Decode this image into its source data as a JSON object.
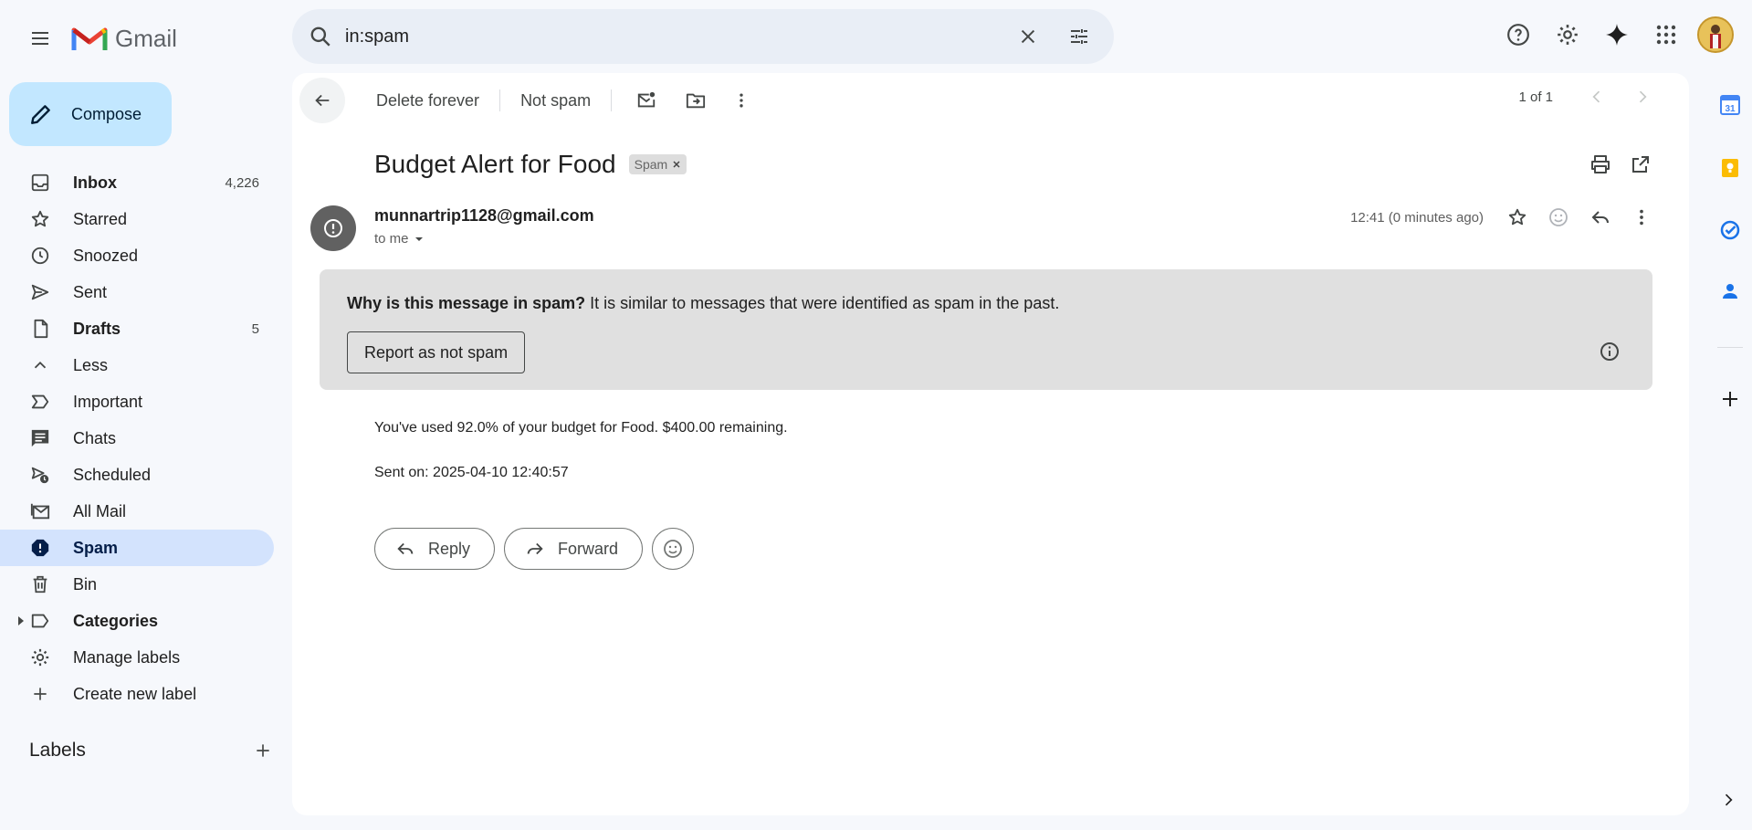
{
  "app": {
    "name": "Gmail"
  },
  "search": {
    "value": "in:spam"
  },
  "compose": {
    "label": "Compose"
  },
  "nav": [
    {
      "label": "Inbox",
      "count": "4,226",
      "icon": "inbox-icon",
      "bold": true
    },
    {
      "label": "Starred",
      "count": "",
      "icon": "star-icon"
    },
    {
      "label": "Snoozed",
      "count": "",
      "icon": "clock-icon"
    },
    {
      "label": "Sent",
      "count": "",
      "icon": "send-icon"
    },
    {
      "label": "Drafts",
      "count": "5",
      "icon": "draft-icon",
      "bold": true
    },
    {
      "label": "Less",
      "count": "",
      "icon": "chevron-up-icon"
    },
    {
      "label": "Important",
      "count": "",
      "icon": "important-icon"
    },
    {
      "label": "Chats",
      "count": "",
      "icon": "chat-icon"
    },
    {
      "label": "Scheduled",
      "count": "",
      "icon": "scheduled-icon"
    },
    {
      "label": "All Mail",
      "count": "",
      "icon": "all-mail-icon"
    },
    {
      "label": "Spam",
      "count": "",
      "icon": "spam-icon",
      "active": true
    },
    {
      "label": "Bin",
      "count": "",
      "icon": "trash-icon"
    },
    {
      "label": "Categories",
      "count": "",
      "icon": "label-icon",
      "bold": true
    },
    {
      "label": "Manage labels",
      "count": "",
      "icon": "gear-icon"
    },
    {
      "label": "Create new label",
      "count": "",
      "icon": "plus-icon"
    }
  ],
  "labels": {
    "title": "Labels"
  },
  "toolbar": {
    "delete_forever": "Delete forever",
    "not_spam": "Not spam"
  },
  "pager": {
    "text": "1 of 1"
  },
  "message": {
    "subject": "Budget Alert for Food",
    "badge": "Spam",
    "sender": "munnartrip1128@gmail.com",
    "to": "to me",
    "time": "12:41 (0 minutes ago)",
    "body_line1": "You've used 92.0% of your budget for Food. $400.00 remaining.",
    "body_line2": "Sent on: 2025-04-10 12:40:57"
  },
  "spam_notice": {
    "question": "Why is this message in spam?",
    "reason": " It is similar to messages that were identified as spam in the past.",
    "button": "Report as not spam"
  },
  "actions": {
    "reply": "Reply",
    "forward": "Forward"
  },
  "rail": {
    "calendar_date": "31"
  },
  "colors": {
    "accent": "#0b57d0",
    "spam_active": "#d3e3fd",
    "compose": "#c2e7ff"
  }
}
